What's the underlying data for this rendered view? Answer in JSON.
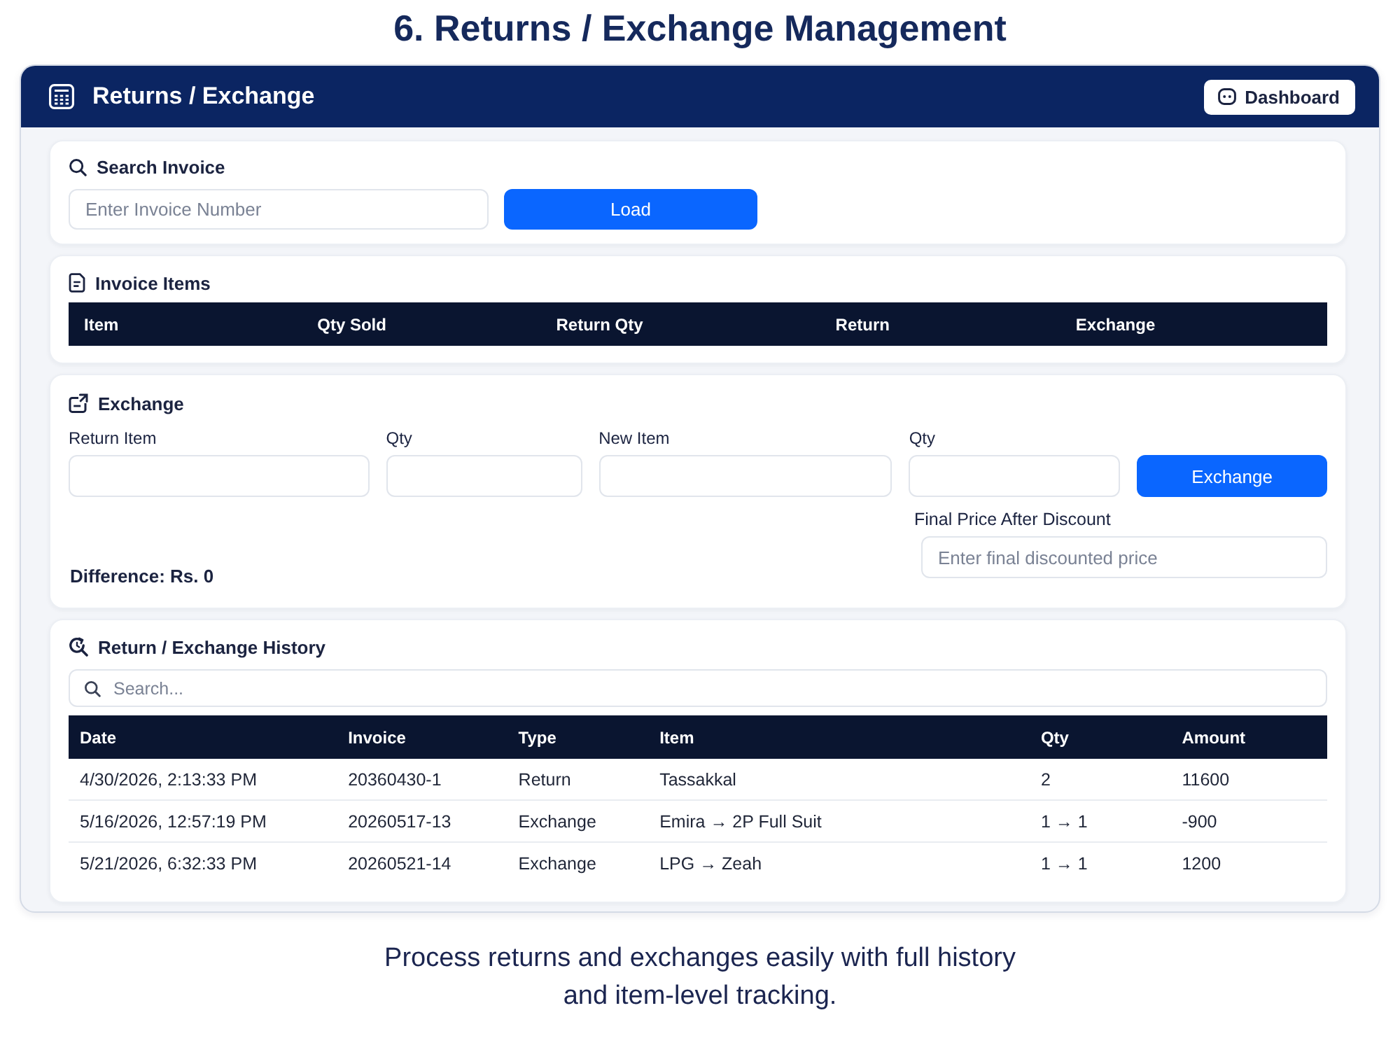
{
  "page_title": "6. Returns / Exchange Management",
  "window": {
    "title": "Returns / Exchange",
    "dashboard_button": "Dashboard"
  },
  "search_invoice": {
    "title": "Search Invoice",
    "invoice_field": {
      "placeholder": "Enter Invoice Number"
    },
    "load_button": "Load"
  },
  "invoice_items": {
    "title": "Invoice Items",
    "columns": [
      "Item",
      "Qty Sold",
      "Return Qty",
      "Return",
      "Exchange"
    ]
  },
  "exchange": {
    "title": "Exchange",
    "fields": [
      {
        "label": "Return Item"
      },
      {
        "label": "Qty"
      },
      {
        "label": "New Item"
      },
      {
        "label": "Qty"
      }
    ],
    "exchange_button": "Exchange",
    "final_price": {
      "label": "Final Price After Discount",
      "placeholder": "Enter final discounted price"
    },
    "difference": "Difference: Rs. 0"
  },
  "history": {
    "title": "Return / Exchange History",
    "search": {
      "placeholder": "Search..."
    },
    "columns": [
      "Date",
      "Invoice",
      "Type",
      "Item",
      "Qty",
      "Amount"
    ],
    "rows": [
      [
        "4/30/2026, 2:13:33 PM",
        "20360430-1",
        "Return",
        "Tassakkal",
        "2",
        "11600"
      ],
      [
        "5/16/2026, 12:57:19 PM",
        "20260517-13",
        "Exchange",
        "Emira → 2P Full Suit",
        "1 → 1",
        "-900"
      ],
      [
        "5/21/2026, 6:32:33 PM",
        "20260521-14",
        "Exchange",
        "LPG → Zeah",
        "1 → 1",
        "1200"
      ]
    ]
  },
  "caption": "Process returns and exchanges easily with full history\nand item-level tracking."
}
